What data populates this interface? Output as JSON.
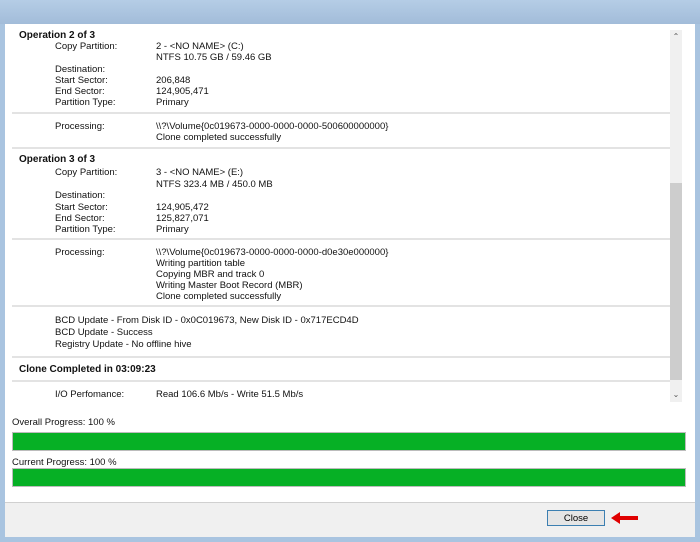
{
  "operations": [
    {
      "title": "Operation 2 of 3",
      "copy_label": "Copy Partition:",
      "copy_value": "2 - <NO NAME> (C:)",
      "fs_value": "NTFS 10.75 GB / 59.46 GB",
      "dest_label": "Destination:",
      "start_label": "Start Sector:",
      "start_value": "206,848",
      "end_label": "End Sector:",
      "end_value": "124,905,471",
      "type_label": "Partition Type:",
      "type_value": "Primary",
      "proc_label": "Processing:",
      "proc_lines": [
        "\\\\?\\Volume{0c019673-0000-0000-0000-500600000000}",
        "Clone completed successfully"
      ]
    },
    {
      "title": "Operation 3 of 3",
      "copy_label": "Copy Partition:",
      "copy_value": "3 - <NO NAME> (E:)",
      "fs_value": "NTFS 323.4 MB / 450.0 MB",
      "dest_label": "Destination:",
      "start_label": "Start Sector:",
      "start_value": "124,905,472",
      "end_label": "End Sector:",
      "end_value": "125,827,071",
      "type_label": "Partition Type:",
      "type_value": "Primary",
      "proc_label": "Processing:",
      "proc_lines": [
        "\\\\?\\Volume{0c019673-0000-0000-0000-d0e30e000000}",
        "Writing partition table",
        "Copying MBR and track 0",
        "Writing Master Boot Record (MBR)",
        "Clone completed successfully"
      ]
    }
  ],
  "bcd_lines": [
    "BCD Update - From Disk ID - 0x0C019673,  New Disk ID - 0x717ECD4D",
    "BCD Update - Success",
    "Registry Update - No offline hive"
  ],
  "completed": "Clone Completed in 03:09:23",
  "io_label": "I/O Perfomance:",
  "io_value": "Read 106.6 Mb/s - Write 51.5 Mb/s",
  "overall": {
    "label": "Overall Progress:  100 %",
    "percent": 100
  },
  "current": {
    "label": "Current Progress:  100 %",
    "percent": 100
  },
  "close_label": "Close",
  "colors": {
    "progress": "#06b025",
    "arrow": "#e00000"
  }
}
